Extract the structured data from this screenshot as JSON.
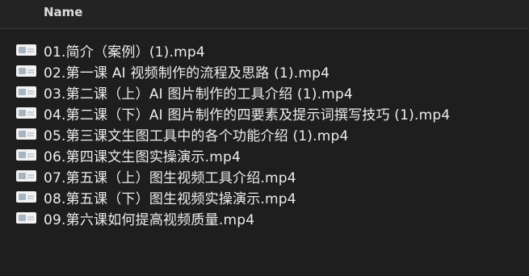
{
  "header": {
    "name_column_label": "Name"
  },
  "files": [
    {
      "name": "01.简介（案例）(1).mp4",
      "icon": "video-file-thumbnail-icon"
    },
    {
      "name": "02.第一课 AI 视频制作的流程及思路 (1).mp4",
      "icon": "video-file-thumbnail-icon"
    },
    {
      "name": "03.第二课（上）AI 图片制作的工具介绍 (1).mp4",
      "icon": "video-file-thumbnail-icon"
    },
    {
      "name": "04.第二课（下）AI 图片制作的四要素及提示词撰写技巧 (1).mp4",
      "icon": "video-file-thumbnail-icon"
    },
    {
      "name": "05.第三课文生图工具中的各个功能介绍 (1).mp4",
      "icon": "video-file-thumbnail-icon"
    },
    {
      "name": "06.第四课文生图实操演示.mp4",
      "icon": "video-file-thumbnail-icon"
    },
    {
      "name": "07.第五课（上）图生视频工具介绍.mp4",
      "icon": "video-file-thumbnail-icon"
    },
    {
      "name": "08.第五课（下）图生视频实操演示.mp4",
      "icon": "video-file-thumbnail-icon"
    },
    {
      "name": "09.第六课如何提高视频质量.mp4",
      "icon": "video-file-thumbnail-icon"
    }
  ]
}
